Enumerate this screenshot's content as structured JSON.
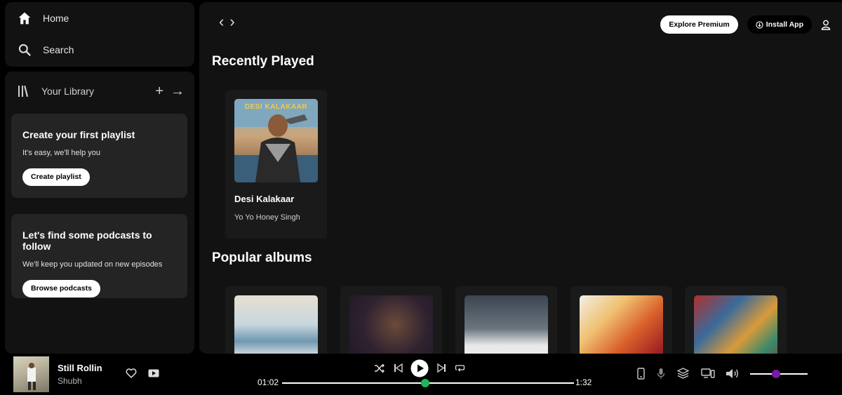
{
  "sidebar": {
    "home_label": "Home",
    "search_label": "Search",
    "library_label": "Your Library",
    "playlist_promo": {
      "title": "Create your first playlist",
      "text": "It's easy, we'll help you",
      "button": "Create playlist"
    },
    "podcast_promo": {
      "title": "Let's find some podcasts to follow",
      "text": "We'll keep you updated on new episodes",
      "button": "Browse podcasts"
    }
  },
  "header": {
    "premium_label": "Explore Premium",
    "install_label": "Install App"
  },
  "main": {
    "recently_played_title": "Recently Played",
    "recently_played": [
      {
        "title": "Desi Kalakaar",
        "artist": "Yo Yo Honey Singh",
        "cover_text": "DESI KALAKAAR"
      }
    ],
    "popular_albums_title": "Popular albums"
  },
  "player": {
    "track_title": "Still Rollin",
    "track_artist": "Shubh",
    "current_time": "01:02",
    "total_time": "1:32",
    "progress_fraction": 0.49,
    "volume_fraction": 0.45
  },
  "colors": {
    "accent_green": "#1db954",
    "volume_purple": "#7a1aa6",
    "panel": "#121212",
    "card": "#1a1a1a"
  }
}
